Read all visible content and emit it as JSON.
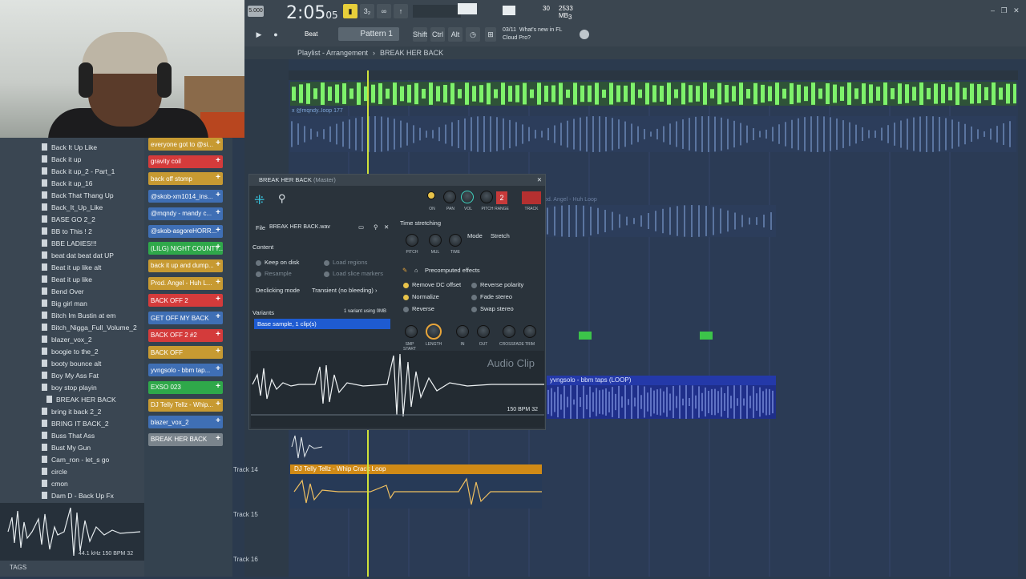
{
  "toolbar": {
    "bpm_badge": "5.000",
    "time": "2:05",
    "time_sub": "05",
    "pattern": "Pattern 1",
    "beat": "Beat",
    "shift": "Shift",
    "ctrl": "Ctrl",
    "alt": "Alt",
    "cpu_num": "30",
    "mem": "2533 MB",
    "voices": "3",
    "news_date": "03/11",
    "news_text": "What's new in FL",
    "news_text2": "Cloud Pro?"
  },
  "playlist": {
    "title": "Playlist - Arrangement",
    "arrangement": "BREAK HER BACK",
    "track_labels": [
      "Track 14",
      "Track 15",
      "Track 16"
    ],
    "clip_pattern": "x @mqndy..loop 177",
    "clip_huh": "Prod. Angel - Huh Loop",
    "clip_yng": "yvngsolo - bbm taps (LOOP)",
    "clip_telly": "DJ Telly Tellz - Whip Crack Loop",
    "clip_icon": "×"
  },
  "browser": {
    "items": [
      "Back It Up Like",
      "Back it up",
      "Back it up_2 - Part_1",
      "Back it up_16",
      "Back That Thang Up",
      "Back_It_Up_Like",
      "BASE GO 2_2",
      "BB to This ! 2",
      "BBE LADIES!!!",
      "beat dat beat dat UP",
      "Beat it up like alt",
      "Beat it up like",
      "Bend Over",
      "Big girl man",
      "Bitch Im Bustin at em",
      "Bitch_Nigga_Full_Volume_2",
      "blazer_vox_2",
      "boogie to the_2",
      "booty bounce alt",
      "Boy My Ass Fat",
      "boy stop playin",
      "BREAK HER BACK",
      "bring it back 2_2",
      "BRING IT BACK_2",
      "Buss That Ass",
      "Bust My Gun",
      "Cam_ron - let_s go",
      "circle",
      "cmon",
      "Dam D - Back Up Fx"
    ],
    "selected": "BREAK HER BACK",
    "wave_info": "44.1 kHz 150 BPM 32",
    "tags": "TAGS"
  },
  "channels": [
    {
      "label": "everyone got to @si...",
      "color": "#c79a32"
    },
    {
      "label": "gravity coil",
      "color": "#d43b3b"
    },
    {
      "label": "back off stomp",
      "color": "#c79a32"
    },
    {
      "label": "@skob-xm1014_ins...",
      "color": "#3f6fb5"
    },
    {
      "label": "@mqndy - mandy c...",
      "color": "#3f6fb5"
    },
    {
      "label": "@skob-asgoreHORR...",
      "color": "#3f6fb5"
    },
    {
      "label": "(LILG) NIGHT COUNTY...",
      "color": "#2fa84a"
    },
    {
      "label": "back it up and dump...",
      "color": "#c79a32"
    },
    {
      "label": "Prod. Angel - Huh L...",
      "color": "#c79a32"
    },
    {
      "label": "BACK OFF 2",
      "color": "#d43b3b"
    },
    {
      "label": "GET OFF MY BACK",
      "color": "#3f6fb5"
    },
    {
      "label": "BACK OFF 2 #2",
      "color": "#d43b3b"
    },
    {
      "label": "BACK OFF",
      "color": "#c79a32"
    },
    {
      "label": "yvngsolo - bbm tap...",
      "color": "#3f6fb5"
    },
    {
      "label": "EXSO 023",
      "color": "#2fa84a"
    },
    {
      "label": "DJ Telly Tellz - Whip...",
      "color": "#c79a32"
    },
    {
      "label": "blazer_vox_2",
      "color": "#3f6fb5"
    },
    {
      "label": "BREAK HER BACK",
      "color": "#7a848c"
    }
  ],
  "plugin": {
    "title": "BREAK HER BACK",
    "title_suffix": "(Master)",
    "file_label": "File",
    "file_name": "BREAK HER BACK.wav",
    "content": "Content",
    "keep_on_disk": "Keep on disk",
    "resample": "Resample",
    "load_regions": "Load regions",
    "load_slice": "Load slice markers",
    "declicking": "Declicking mode",
    "declicking_val": "Transient (no bleeding)",
    "variants": "Variants",
    "variants_info": "1 variant using 0MB",
    "variant_sel": "Base sample, 1 clip(s)",
    "time_stretching": "Time stretching",
    "mode": "Mode",
    "mode_val": "Stretch",
    "precomputed": "Precomputed effects",
    "fx": [
      "Remove DC offset",
      "Normalize",
      "Reverse",
      "Reverse polarity",
      "Fade stereo",
      "Swap stereo"
    ],
    "top_knobs": [
      "ON",
      "PAN",
      "VOL",
      "PITCH",
      "RANGE",
      "TRACK"
    ],
    "range_num": "2",
    "ts_knobs": [
      "PITCH",
      "MUL",
      "TIME"
    ],
    "bottom_knobs": [
      "SMP START",
      "LENGTH",
      "IN",
      "OUT",
      "CROSSFADE",
      "TRIM"
    ],
    "audio_clip": "Audio Clip",
    "bpm_info": "150 BPM 32"
  }
}
